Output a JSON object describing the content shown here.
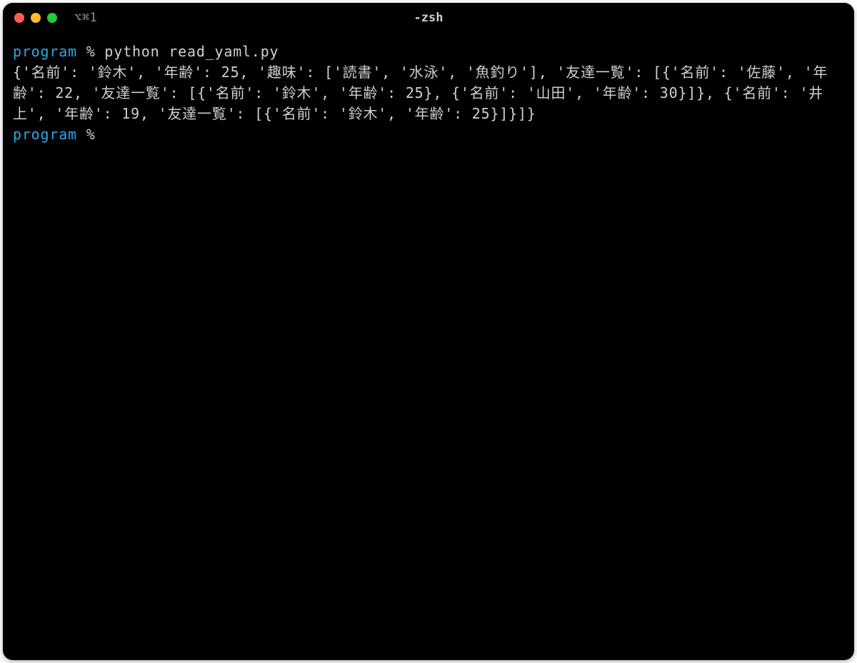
{
  "titlebar": {
    "tab_label": "⌥⌘1",
    "window_title": "-zsh"
  },
  "terminal": {
    "lines": [
      {
        "type": "prompt",
        "dir": "program",
        "sep": " % ",
        "cmd": "python read_yaml.py"
      },
      {
        "type": "output",
        "text": "{'名前': '鈴木', '年齢': 25, '趣味': ['読書', '水泳', '魚釣り'], '友達一覧': [{'名前': '佐藤', '年齢': 22, '友達一覧': [{'名前': '鈴木', '年齢': 25}, {'名前': '山田', '年齢': 30}]}, {'名前': '井上', '年齢': 19, '友達一覧': [{'名前': '鈴木', '年齢': 25}]}]}"
      },
      {
        "type": "prompt",
        "dir": "program",
        "sep": " % ",
        "cmd": ""
      }
    ]
  },
  "colors": {
    "background": "#000000",
    "foreground": "#d0d0d0",
    "prompt_dir": "#2aa7e6",
    "traffic_red": "#ff5f57",
    "traffic_yellow": "#febc2e",
    "traffic_green": "#28c840"
  }
}
